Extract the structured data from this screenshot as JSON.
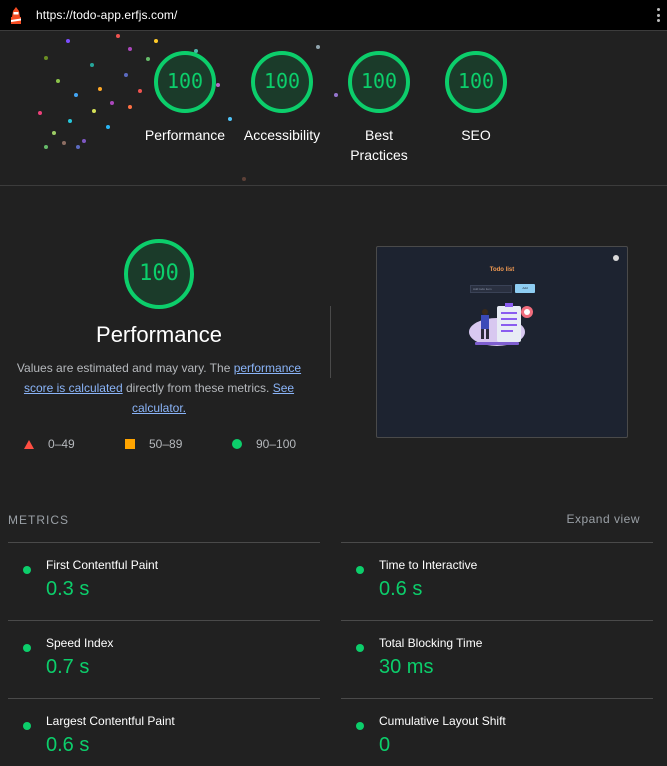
{
  "browser": {
    "url": "https://todo-app.erfjs.com/"
  },
  "summary_gauges": [
    {
      "score": "100",
      "label": "Performance"
    },
    {
      "score": "100",
      "label": "Accessibility"
    },
    {
      "score": "100",
      "label": "Best Practices"
    },
    {
      "score": "100",
      "label": "SEO"
    }
  ],
  "performance": {
    "score": "100",
    "title": "Performance",
    "desc_before": "Values are estimated and may vary. The ",
    "link_score": "performance score is calculated",
    "desc_middle": " directly from these metrics. ",
    "link_calc": "See calculator."
  },
  "legend": {
    "fail": "0–49",
    "average": "50–89",
    "pass": "90–100"
  },
  "thumbnail": {
    "title": "Todo list",
    "input_placeholder": "Add todo item",
    "button": "Add"
  },
  "metrics": {
    "heading": "METRICS",
    "expand": "Expand view",
    "items": [
      {
        "label": "First Contentful Paint",
        "value": "0.3 s"
      },
      {
        "label": "Time to Interactive",
        "value": "0.6 s"
      },
      {
        "label": "Speed Index",
        "value": "0.7 s"
      },
      {
        "label": "Total Blocking Time",
        "value": "30 ms"
      },
      {
        "label": "Largest Contentful Paint",
        "value": "0.6 s"
      },
      {
        "label": "Cumulative Layout Shift",
        "value": "0"
      }
    ]
  },
  "colors": {
    "pass": "#0cce6b",
    "average": "#ffa400",
    "fail": "#ff4e42",
    "link": "#8ab4f8"
  }
}
